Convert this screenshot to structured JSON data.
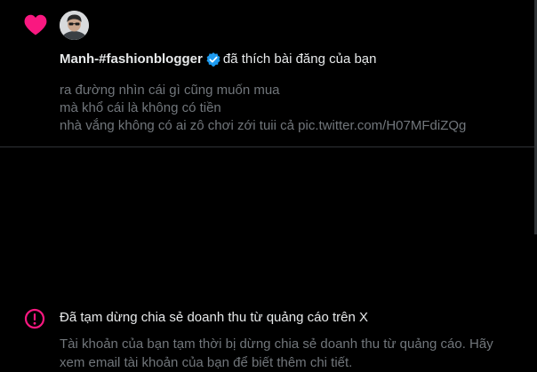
{
  "colors": {
    "background": "#000000",
    "like_heart": "#f91880",
    "alert_pink": "#f91880",
    "verified_blue": "#1d9bf0",
    "primary_text": "#e7e9ea",
    "secondary_text": "#71767b",
    "divider": "#2f3336"
  },
  "like_notification": {
    "icon": "heart-icon",
    "user_name": "Manh-#fashionblogger",
    "verified_icon": "verified-badge-icon",
    "action_text": "đã thích bài đăng của bạn",
    "tweet_lines": [
      "ra đường nhìn cái gì cũng muốn mua",
      "mà khổ cái là không có tiền",
      "nhà vắng không có ai zô chơi zới tuii cả pic.twitter.com/H07MFdiZQg"
    ]
  },
  "alert_notification": {
    "icon": "alert-circle-icon",
    "title": "Đã tạm dừng chia sẻ doanh thu từ quảng cáo trên X",
    "body": "Tài khoản của bạn tạm thời bị dừng chia sẻ doanh thu từ quảng cáo. Hãy xem email tài khoản của bạn để biết thêm chi tiết."
  }
}
